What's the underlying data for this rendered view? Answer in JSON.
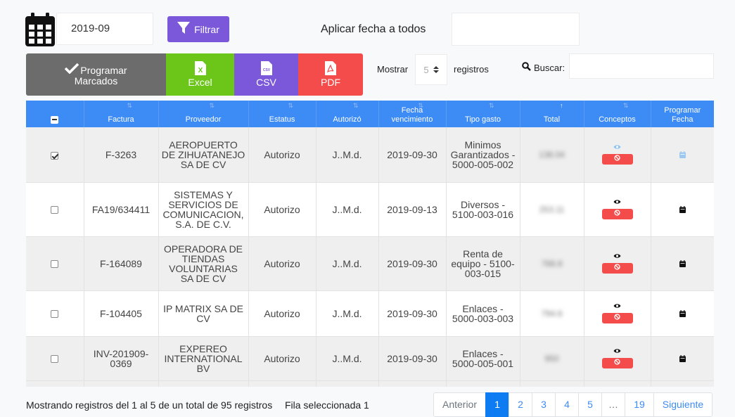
{
  "toolbar": {
    "date_value": "2019-09",
    "filter_label": "Filtrar",
    "apply_date_label": "Aplicar fecha a todos",
    "program_label_1": "Programar",
    "program_label_2": "Marcados",
    "excel_label": "Excel",
    "excel_icon_letter": "X",
    "csv_label": "CSV",
    "csv_icon_text": "CSV",
    "pdf_label": "PDF",
    "show_label": "Mostrar",
    "page_size": "5",
    "records_label": "registros",
    "search_label": "Buscar:"
  },
  "table": {
    "columns": [
      "Factura",
      "Proveedor",
      "Estatus",
      "Autorizó",
      "Fecha vencimiento",
      "Tipo gasto",
      "Total",
      "Conceptos",
      "Programar Fecha"
    ],
    "rows": [
      {
        "checked": true,
        "factura": "F-3263",
        "proveedor": "AEROPUERTO DE ZIHUATANEJO SA DE CV",
        "estatus": "Autorizo",
        "autorizo": "J..M.d.",
        "fecha": "2019-09-30",
        "tipo_gasto": "Minimos Garantizados - 5000-005-002",
        "total": "138.04"
      },
      {
        "checked": false,
        "factura": "FA19/634411",
        "proveedor": "SISTEMAS Y SERVICIOS DE COMUNICACION, S.A. DE C.V.",
        "estatus": "Autorizo",
        "autorizo": "J..M.d.",
        "fecha": "2019-09-13",
        "tipo_gasto": "Diversos - 5100-003-016",
        "total": "253.11"
      },
      {
        "checked": false,
        "factura": "F-164089",
        "proveedor": "OPERADORA DE TIENDAS VOLUNTARIAS SA DE CV",
        "estatus": "Autorizo",
        "autorizo": "J..M.d.",
        "fecha": "2019-09-30",
        "tipo_gasto": "Renta de equipo - 5100-003-015",
        "total": "788.8"
      },
      {
        "checked": false,
        "factura": "F-104405",
        "proveedor": "IP MATRIX SA DE CV",
        "estatus": "Autorizo",
        "autorizo": "J..M.d.",
        "fecha": "2019-09-30",
        "tipo_gasto": "Enlaces - 5000-003-003",
        "total": "794.6"
      },
      {
        "checked": false,
        "factura": "INV-201909-0369",
        "proveedor": "EXPEREO INTERNATIONAL BV",
        "estatus": "Autorizo",
        "autorizo": "J..M.d.",
        "fecha": "2019-09-30",
        "tipo_gasto": "Enlaces - 5000-005-001",
        "total": "950"
      }
    ]
  },
  "footer": {
    "info": "Mostrando registros del 1 al 5 de un total de 95 registros",
    "selected": "Fila seleccionada 1",
    "prev": "Anterior",
    "pages": [
      "1",
      "2",
      "3",
      "4",
      "5",
      "…",
      "19"
    ],
    "active_page": "1",
    "next": "Siguiente"
  },
  "colors": {
    "header_blue": "#3d8bf4",
    "filter_purple": "#7b58d9",
    "program_gray": "#6c6c6c",
    "excel_green": "#6bc619",
    "pdf_red": "#f44b4b",
    "page_active": "#0d7cf2"
  },
  "icons": {
    "calendar": "calendar-icon",
    "filter": "filter-icon",
    "check": "check-icon",
    "excel_file": "excel-file-icon",
    "csv_file": "csv-file-icon",
    "pdf_file": "pdf-file-icon",
    "search": "search-icon",
    "eye": "eye-icon",
    "ban": "ban-icon",
    "sort": "sort-icon"
  }
}
